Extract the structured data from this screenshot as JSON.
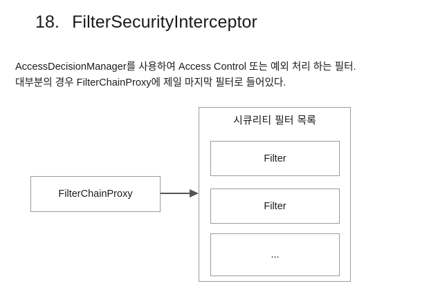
{
  "heading": {
    "number": "18.",
    "text": "FilterSecurityInterceptor"
  },
  "description": {
    "line1": "AccessDecisionManager를 사용하여 Access Control 또는 예외 처리 하는 필터.",
    "line2": "대부분의 경우 FilterChainProxy에 제일 마지막 필터로 들어있다."
  },
  "diagram": {
    "proxy_label": "FilterChainProxy",
    "list_title": "시큐리티 필터 목록",
    "items": [
      "Filter",
      "Filter",
      "..."
    ],
    "arrow_icon": "arrow-right-icon"
  }
}
